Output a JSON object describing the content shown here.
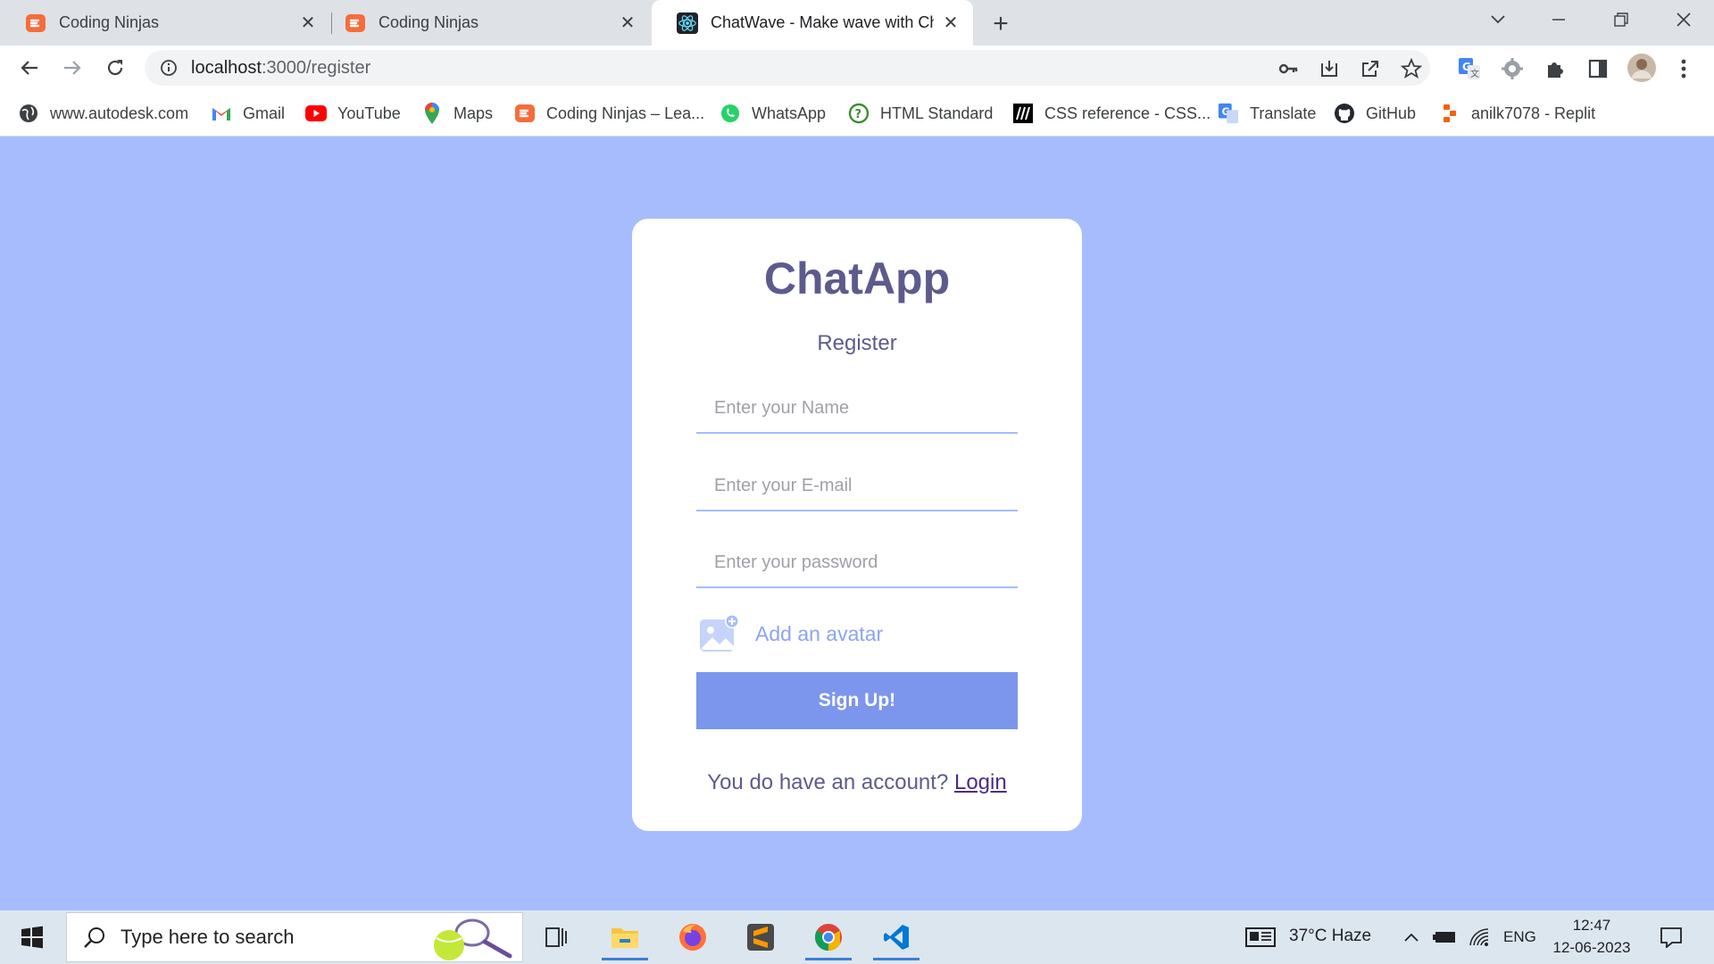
{
  "browser": {
    "tabs": [
      {
        "title": "Coding Ninjas",
        "icon": "coding-ninjas-icon",
        "active": false
      },
      {
        "title": "Coding Ninjas",
        "icon": "coding-ninjas-icon",
        "active": false
      },
      {
        "title": "ChatWave - Make wave with Cha",
        "icon": "react-icon",
        "active": true
      }
    ],
    "address": {
      "host": "localhost",
      "path": ":3000/register"
    },
    "bookmarks": [
      {
        "label": "www.autodesk.com",
        "icon": "globe-icon"
      },
      {
        "label": "Gmail",
        "icon": "gmail-icon"
      },
      {
        "label": "YouTube",
        "icon": "youtube-icon"
      },
      {
        "label": "Maps",
        "icon": "maps-icon"
      },
      {
        "label": "Coding Ninjas – Lea...",
        "icon": "coding-ninjas-icon"
      },
      {
        "label": "WhatsApp",
        "icon": "whatsapp-icon"
      },
      {
        "label": "HTML Standard",
        "icon": "html-standard-icon"
      },
      {
        "label": "CSS reference - CSS...",
        "icon": "mdn-icon"
      },
      {
        "label": "Translate",
        "icon": "translate-icon"
      },
      {
        "label": "GitHub",
        "icon": "github-icon"
      },
      {
        "label": "anilk7078 - Replit",
        "icon": "replit-icon"
      }
    ]
  },
  "register": {
    "logo": "ChatApp",
    "subtitle": "Register",
    "name_placeholder": "Enter your Name",
    "email_placeholder": "Enter your E-mail",
    "password_placeholder": "Enter your password",
    "avatar_label": "Add an avatar",
    "submit_label": "Sign Up!",
    "footer_text": "You do have an account?",
    "login_link": "Login"
  },
  "taskbar": {
    "search_placeholder": "Type here to search",
    "weather": "37°C  Haze",
    "language": "ENG",
    "time": "12:47",
    "date": "12-06-2023"
  },
  "colors": {
    "page_bg": "#a7bcfd",
    "brand_text": "#5d5b8d",
    "button_bg": "#7b96ec",
    "link": "#4a2c8a"
  }
}
